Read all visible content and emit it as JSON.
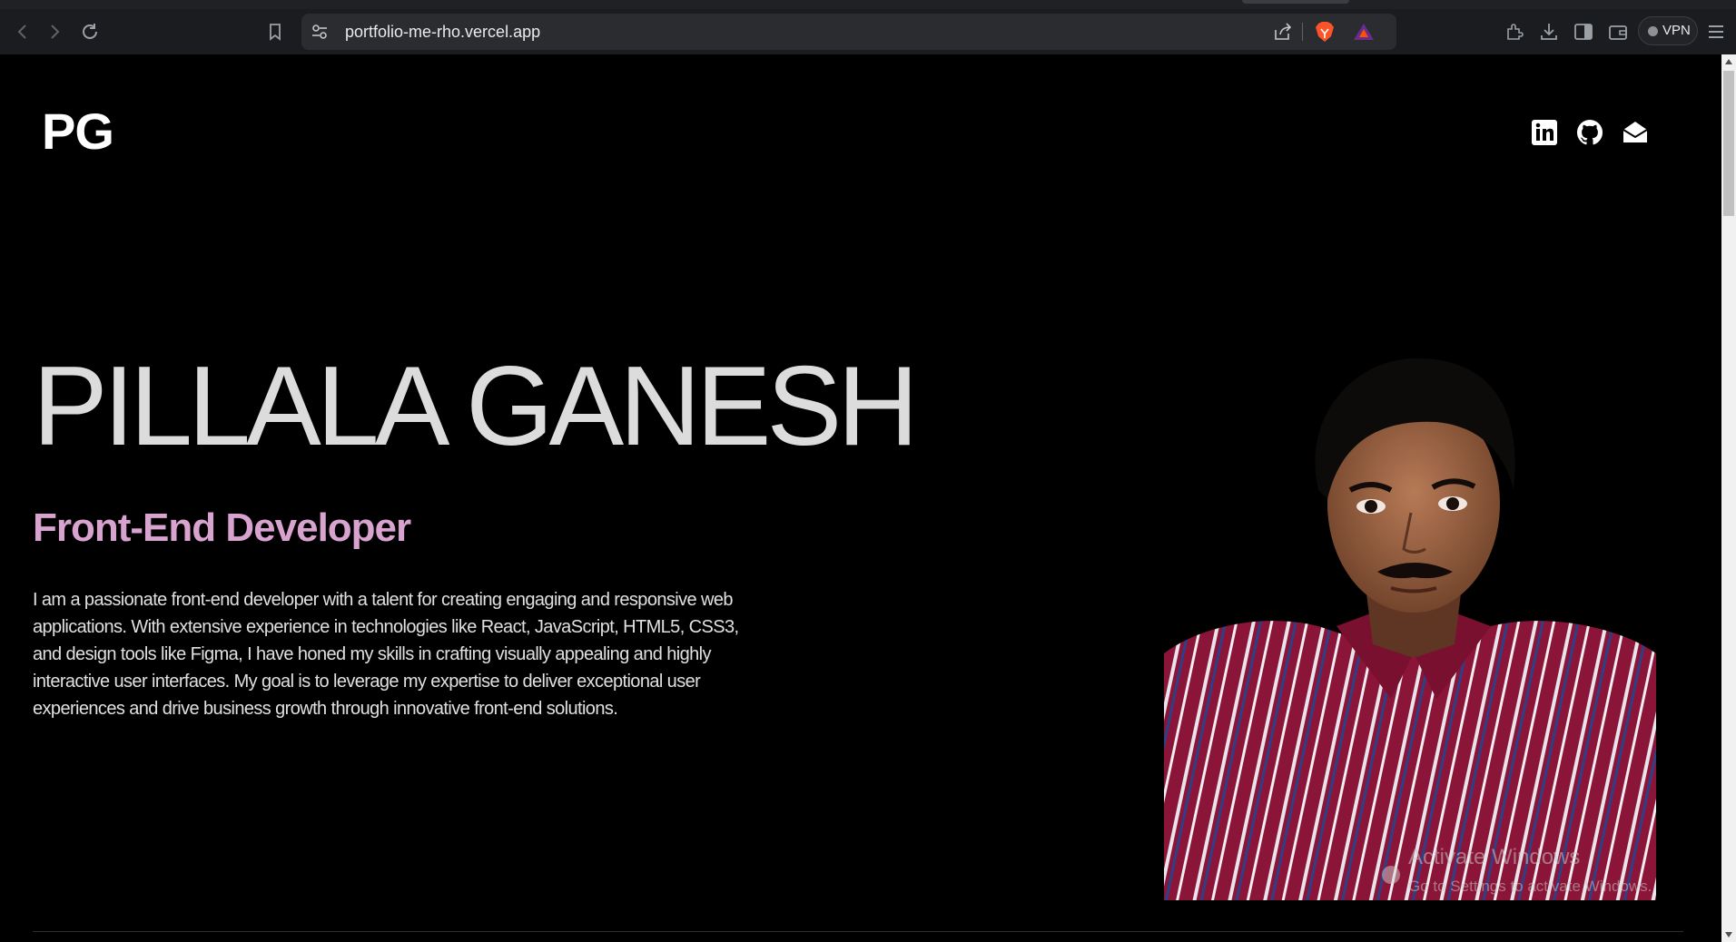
{
  "browser": {
    "url": "portfolio-me-rho.vercel.app",
    "vpn_label": "VPN",
    "icons": [
      "back-icon",
      "forward-icon",
      "reload-icon",
      "bookmark-icon",
      "site-settings-icon",
      "share-icon",
      "brave-shields-icon",
      "brave-rewards-icon",
      "extensions-icon",
      "downloads-icon",
      "sidebar-icon",
      "wallet-icon",
      "menu-icon"
    ]
  },
  "header": {
    "logo": "PG",
    "social_icons": [
      "linkedin-icon",
      "github-icon",
      "mail-icon"
    ]
  },
  "hero": {
    "name": "PILLALA GANESH",
    "role": "Front-End Developer",
    "bio": "I am a passionate front-end developer with a talent for creating engaging and responsive web applications. With extensive experience in technologies like React, JavaScript, HTML5, CSS3, and design tools like Figma, I have honed my skills in crafting visually appealing and highly interactive user interfaces. My goal is to leverage my expertise to deliver exceptional user experiences and drive business growth through innovative front-end solutions."
  },
  "watermark": {
    "title": "Activate Windows",
    "subtitle": "Go to Settings to activate Windows."
  },
  "colors": {
    "background": "#000000",
    "role_accent": "#d9a3cf",
    "name_text": "#dcdcdc",
    "shirt": "#8a1538"
  }
}
